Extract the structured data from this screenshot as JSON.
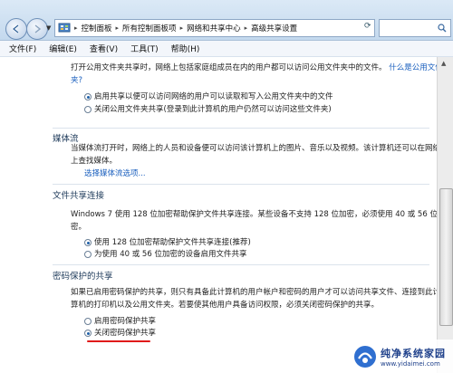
{
  "breadcrumb": [
    "控制面板",
    "所有控制面板项",
    "网络和共享中心",
    "高级共享设置"
  ],
  "menubar": {
    "file": "文件(F)",
    "edit": "编辑(E)",
    "view": "查看(V)",
    "tools": "工具(T)",
    "help": "帮助(H)"
  },
  "public_folder": {
    "line1": "打开公用文件夹共享时，网络上包括家庭组成员在内的用户都可以访问公用文件夹中的文件。",
    "link": "什么是公用文件",
    "link2": "夹?",
    "option_on": "启用共享以便可以访问网络的用户可以读取和写入公用文件夹中的文件",
    "option_off": "关闭公用文件夹共享(登录到此计算机的用户仍然可以访问这些文件夹)"
  },
  "media": {
    "title": "媒体流",
    "line1": "当媒体流打开时，网络上的人员和设备便可以访问该计算机上的图片、音乐以及视频。该计算机还可以在网络",
    "line2": "上查找媒体。",
    "link": "选择媒体流选项..."
  },
  "file_sharing": {
    "title": "文件共享连接",
    "line1": "Windows 7 使用 128 位加密帮助保护文件共享连接。某些设备不支持 128 位加密，必须使用 40 或 56 位加",
    "line2": "密。",
    "option_128": "使用 128 位加密帮助保护文件共享连接(推荐)",
    "option_40": "为使用 40 或 56 位加密的设备启用文件共享"
  },
  "password": {
    "title": "密码保护的共享",
    "line1": "如果已启用密码保护的共享，则只有具备此计算机的用户帐户和密码的用户才可以访问共享文件、连接到此计",
    "line2": "算机的打印机以及公用文件夹。若要使其他用户具备访问权限，必须关闭密码保护的共享。",
    "option_on": "启用密码保护共享",
    "option_off": "关闭密码保护共享"
  },
  "watermark": {
    "title": "纯净系统家园",
    "url": "www.yidaimei.com"
  },
  "colors": {
    "link": "#1a5fbe",
    "accent_red": "#e01a1a",
    "title": "#1e3a5a"
  }
}
